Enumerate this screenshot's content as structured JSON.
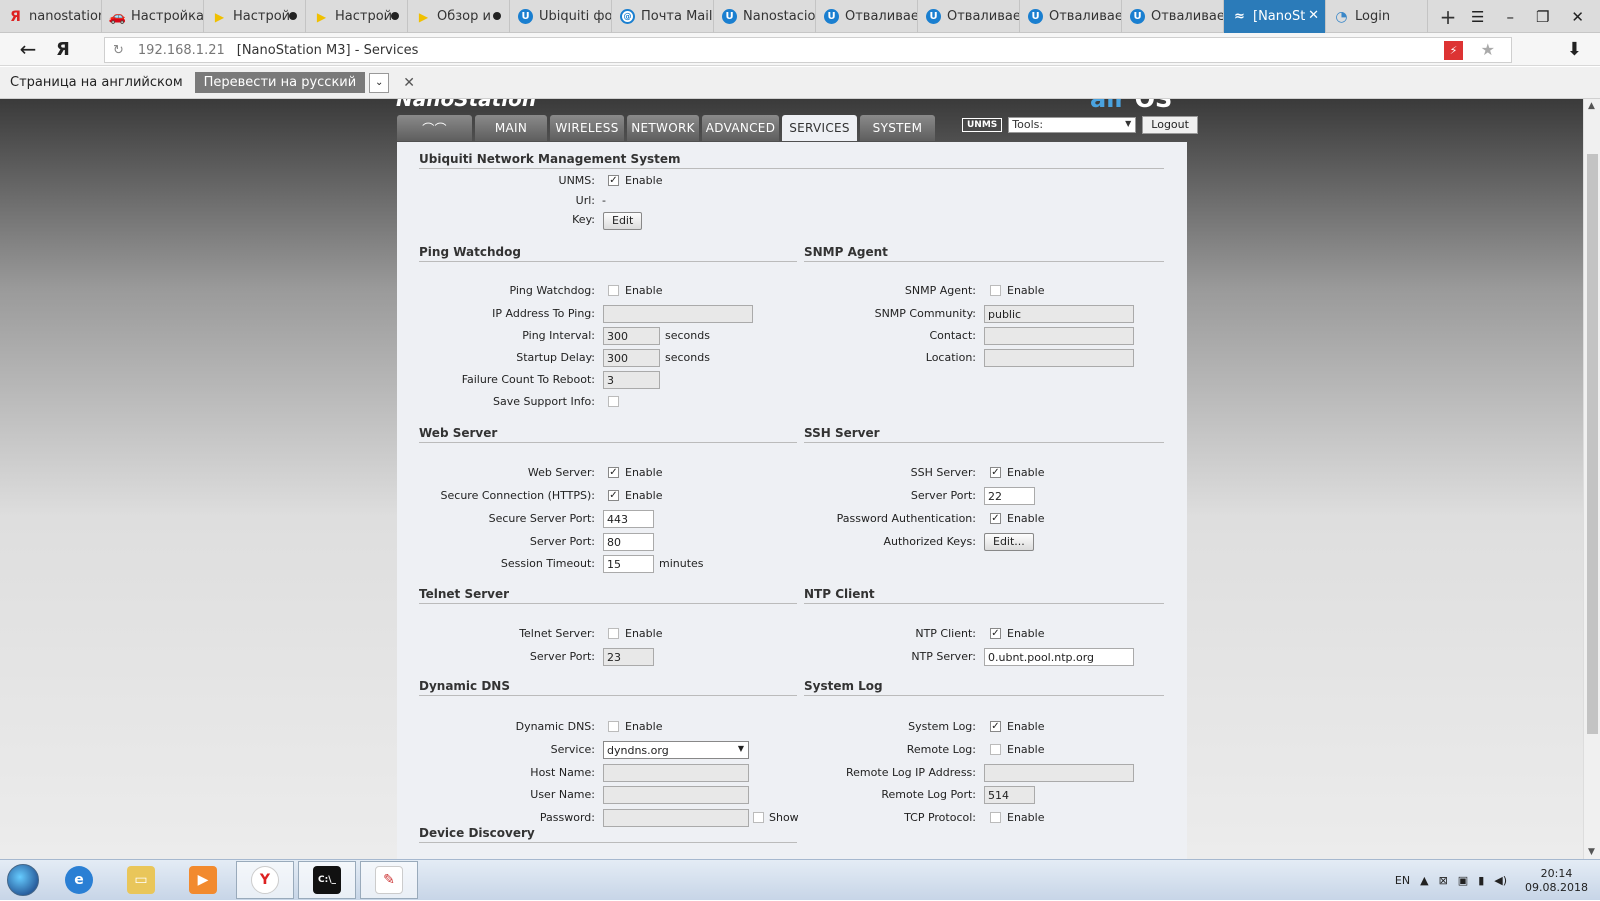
{
  "browser_tabs": [
    {
      "label": "nanostation",
      "icon": "yandex-icon",
      "state": "none"
    },
    {
      "label": "Настройка",
      "icon": "car-icon",
      "state": "none"
    },
    {
      "label": "Настрой",
      "icon": "youtube-icon",
      "state": "dot"
    },
    {
      "label": "Настрой",
      "icon": "youtube-icon",
      "state": "dot"
    },
    {
      "label": "Обзор и",
      "icon": "youtube-icon",
      "state": "dot"
    },
    {
      "label": "Ubiquiti фо",
      "icon": "ubiquiti-icon",
      "state": "none"
    },
    {
      "label": "Почта Mail",
      "icon": "mail-icon",
      "state": "none"
    },
    {
      "label": "Nanostacio",
      "icon": "ubiquiti-icon",
      "state": "none"
    },
    {
      "label": "Отваливае",
      "icon": "ubiquiti-icon",
      "state": "none"
    },
    {
      "label": "Отваливае",
      "icon": "ubiquiti-icon",
      "state": "none"
    },
    {
      "label": "Отваливае",
      "icon": "ubiquiti-icon",
      "state": "none"
    },
    {
      "label": "Отваливае",
      "icon": "ubiquiti-icon",
      "state": "none"
    },
    {
      "label": "[NanoSt",
      "icon": "nanostation-icon",
      "state": "active"
    },
    {
      "label": "Login",
      "icon": "rss-icon",
      "state": "none"
    }
  ],
  "address": {
    "host": "192.168.1.21",
    "title": "[NanoStation M3] - Services"
  },
  "translate": {
    "text": "Страница на английском",
    "button": "Перевести на русский"
  },
  "device": {
    "logo_left": "NanoStation",
    "logo_right_a": "air",
    "logo_right_b": "OS"
  },
  "nav_tabs": [
    "MAIN",
    "WIRELESS",
    "NETWORK",
    "ADVANCED",
    "SERVICES",
    "SYSTEM"
  ],
  "active_tab": "SERVICES",
  "tools": {
    "unms_badge": "UNMS",
    "tools_select": "Tools:",
    "logout": "Logout"
  },
  "unms": {
    "title": "Ubiquiti Network Management System",
    "unms_label": "UNMS:",
    "enable": "Enable",
    "url_label": "Url:",
    "url_value": "-",
    "key_label": "Key:",
    "edit": "Edit"
  },
  "ping": {
    "title": "Ping Watchdog",
    "watchdog_label": "Ping Watchdog:",
    "enable": "Enable",
    "ip_label": "IP Address To Ping:",
    "interval_label": "Ping Interval:",
    "interval": "300",
    "seconds": "seconds",
    "startup_label": "Startup Delay:",
    "startup": "300",
    "failure_label": "Failure Count To Reboot:",
    "failure": "3",
    "support_label": "Save Support Info:"
  },
  "snmp": {
    "title": "SNMP Agent",
    "agent_label": "SNMP Agent:",
    "enable": "Enable",
    "community_label": "SNMP Community:",
    "community": "public",
    "contact_label": "Contact:",
    "location_label": "Location:"
  },
  "web": {
    "title": "Web Server",
    "web_label": "Web Server:",
    "enable": "Enable",
    "https_label": "Secure Connection (HTTPS):",
    "secure_port_label": "Secure Server Port:",
    "secure_port": "443",
    "port_label": "Server Port:",
    "port": "80",
    "timeout_label": "Session Timeout:",
    "timeout": "15",
    "minutes": "minutes"
  },
  "ssh": {
    "title": "SSH Server",
    "ssh_label": "SSH Server:",
    "enable": "Enable",
    "port_label": "Server Port:",
    "port": "22",
    "pass_label": "Password Authentication:",
    "keys_label": "Authorized Keys:",
    "edit": "Edit..."
  },
  "telnet": {
    "title": "Telnet Server",
    "telnet_label": "Telnet Server:",
    "enable": "Enable",
    "port_label": "Server Port:",
    "port": "23"
  },
  "ntp": {
    "title": "NTP Client",
    "ntp_label": "NTP Client:",
    "enable": "Enable",
    "server_label": "NTP Server:",
    "server": "0.ubnt.pool.ntp.org"
  },
  "ddns": {
    "title": "Dynamic DNS",
    "ddns_label": "Dynamic DNS:",
    "enable": "Enable",
    "service_label": "Service:",
    "service": "dyndns.org",
    "host_label": "Host Name:",
    "user_label": "User Name:",
    "pass_label": "Password:",
    "show": "Show"
  },
  "syslog": {
    "title": "System Log",
    "syslog_label": "System Log:",
    "enable": "Enable",
    "remote_label": "Remote Log:",
    "remote_ip_label": "Remote Log IP Address:",
    "remote_port_label": "Remote Log Port:",
    "remote_port": "514",
    "tcp_label": "TCP Protocol:"
  },
  "discovery": {
    "title": "Device Discovery"
  },
  "tray": {
    "lang": "EN",
    "time": "20:14",
    "date": "09.08.2018"
  },
  "taskbar": [
    "ie-icon",
    "explorer-icon",
    "media-player-icon",
    "yandex-browser-icon",
    "cmd-icon",
    "paint-icon"
  ]
}
